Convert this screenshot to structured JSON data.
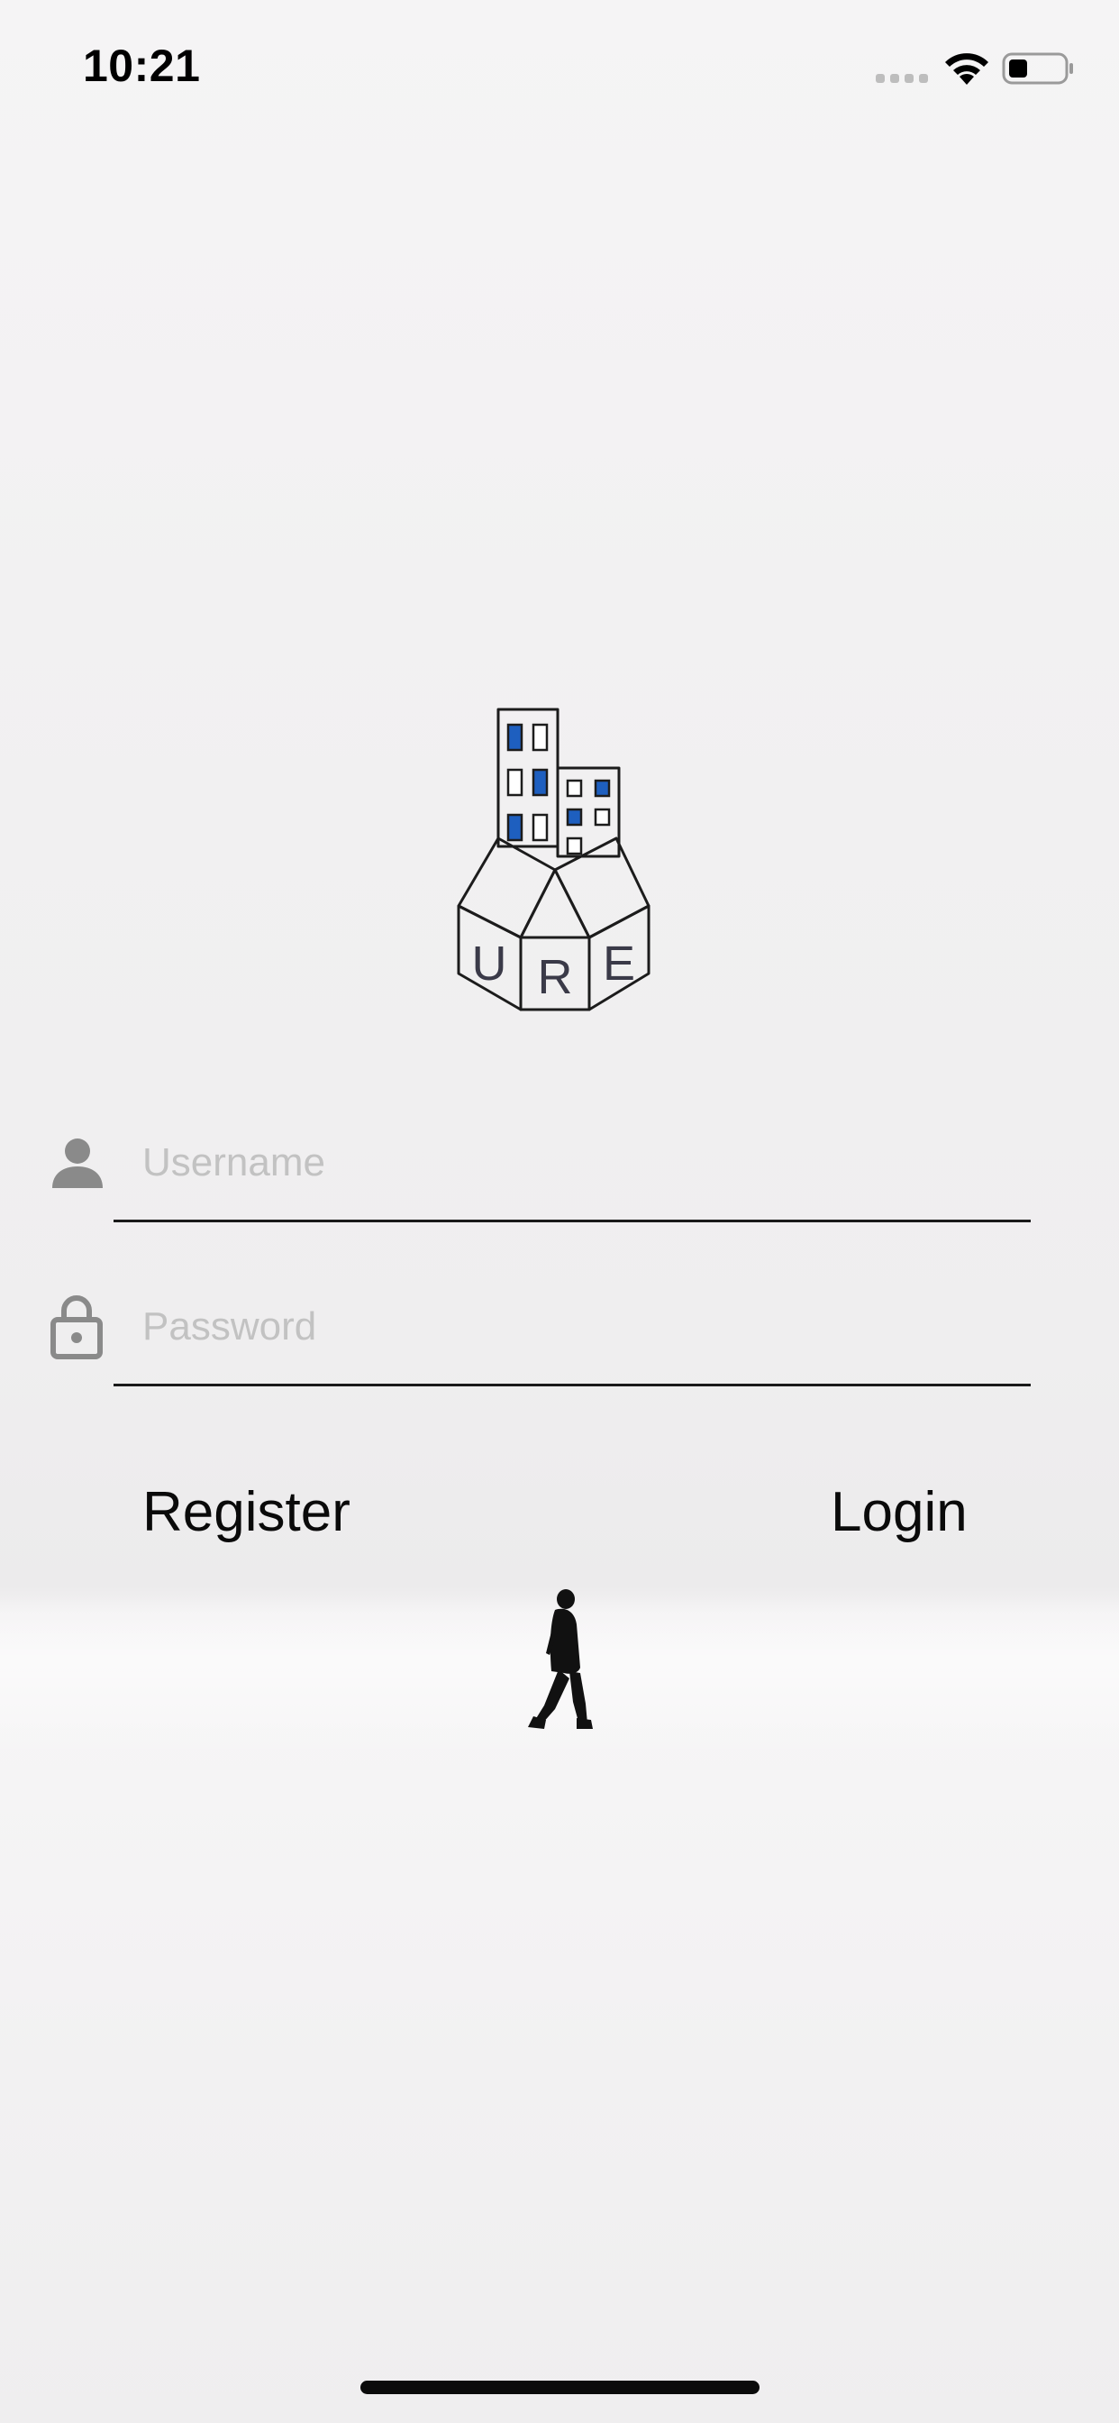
{
  "status_bar": {
    "time": "10:21",
    "signal_icon": "signal-dots-icon",
    "wifi_icon": "wifi-icon",
    "battery_icon": "battery-icon",
    "battery_level": 0.35
  },
  "logo": {
    "icon": "buildings-house-logo",
    "letters": [
      "U",
      "R",
      "E"
    ],
    "accent_color": "#1e5fbf",
    "stroke_color": "#1c1c1c"
  },
  "login_form": {
    "username": {
      "icon": "user-icon",
      "placeholder": "Username",
      "value": ""
    },
    "password": {
      "icon": "lock-icon",
      "placeholder": "Password",
      "value": ""
    },
    "register_label": "Register",
    "login_label": "Login"
  },
  "colors": {
    "background": "#f3f2f3",
    "icon_gray": "#8a8a8a",
    "placeholder_gray": "#c2c2c2",
    "text": "#0a0a0a"
  }
}
